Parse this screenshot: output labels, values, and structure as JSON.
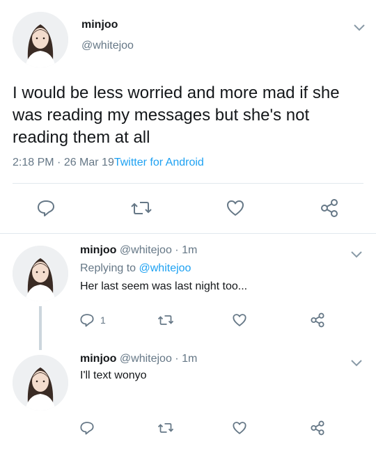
{
  "main_tweet": {
    "name": "minjoo",
    "handle": "@whitejoo",
    "text": "I would be less worried and more mad if she was reading my messages but she's not reading them at all",
    "time": "2:18 PM",
    "sep": " · ",
    "date": "26 Mar 19",
    "source": "Twitter for Android"
  },
  "replies": [
    {
      "name": "minjoo",
      "handle": "@whitejoo",
      "age": "· 1m",
      "replying_prefix": "Replying to ",
      "replying_to": "@whitejoo",
      "text": "Her last seem was last night too...",
      "reply_count": "1"
    },
    {
      "name": "minjoo",
      "handle": "@whitejoo",
      "age": "· 1m",
      "text": "I'll text wonyo"
    }
  ],
  "icons": {
    "reply": "reply-icon",
    "retweet": "retweet-icon",
    "like": "heart-icon",
    "share": "share-icon",
    "menu": "chevron-down-icon"
  },
  "colors": {
    "icon": "#657786",
    "link": "#1da1f2",
    "divider": "#e1e8ed",
    "thread_line": "#ccd6dd"
  }
}
